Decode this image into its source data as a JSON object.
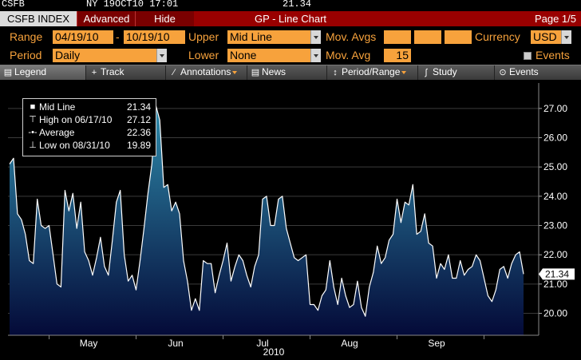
{
  "ticker": {
    "code": "CSFB",
    "exchange_date": "NY 19OCT10 17:01",
    "last": "21.34"
  },
  "titlebar": {
    "index_label": "CSFB INDEX",
    "advanced_label": "Advanced",
    "hide_label": "Hide",
    "title": "GP - Line Chart",
    "page": "Page 1/5"
  },
  "controls": {
    "range_label": "Range",
    "range_start": "04/19/10",
    "range_dash": "-",
    "range_end": "10/19/10",
    "upper_label": "Upper",
    "upper_value": "Mid Line",
    "mov_avgs_label": "Mov. Avgs",
    "currency_label": "Currency",
    "currency_value": "USD",
    "period_label": "Period",
    "period_value": "Daily",
    "lower_label": "Lower",
    "lower_value": "None",
    "mov_avg_label": "Mov. Avg",
    "mov_avg_value": "15",
    "events_label": "Events"
  },
  "toolbar": {
    "legend": "Legend",
    "track": "Track",
    "annotations": "Annotations",
    "news": "News",
    "period_range": "Period/Range",
    "study": "Study",
    "events": "Events"
  },
  "legend": {
    "mid_label": "Mid Line",
    "mid_value": "21.34",
    "high_label": "High on 06/17/10",
    "high_value": "27.12",
    "avg_label": "Average",
    "avg_value": "22.36",
    "low_label": "Low on 08/31/10",
    "low_value": "19.89"
  },
  "chart_data": {
    "type": "area",
    "year_label": "2010",
    "last_value": 21.34,
    "ylim": [
      19.25,
      27.65
    ],
    "y_ticks": [
      "27.00",
      "26.00",
      "25.00",
      "24.00",
      "23.00",
      "22.00",
      "21.00",
      "20.00"
    ],
    "x_ticks": [
      {
        "label": "May",
        "at": 20.0
      },
      {
        "label": "Jun",
        "at": 42.0
      },
      {
        "label": "Jul",
        "at": 64.0
      },
      {
        "label": "Aug",
        "at": 86.0
      },
      {
        "label": "Sep",
        "at": 108.0
      }
    ],
    "colors": {
      "line": "#ffffff",
      "fill_top": "#2f8cac",
      "fill_bottom": "#040a38",
      "grid": "#3a3a3a",
      "axis_text": "#ffffff"
    },
    "series": [
      {
        "x": [
          0,
          1,
          2,
          3,
          4,
          5,
          6,
          7,
          8,
          9,
          10,
          11,
          12,
          13,
          14,
          15,
          16,
          17,
          18,
          19,
          20,
          21,
          22,
          23,
          24,
          25,
          26,
          27,
          28,
          29,
          30,
          31,
          32,
          33,
          34,
          35,
          36,
          37,
          38,
          39,
          40,
          41,
          42,
          43,
          44,
          45,
          46,
          47,
          48,
          49,
          50,
          51,
          52,
          53,
          54,
          55,
          56,
          57,
          58,
          59,
          60,
          61,
          62,
          63,
          64,
          65,
          66,
          67,
          68,
          69,
          70,
          71,
          72,
          73,
          74,
          75,
          76,
          77,
          78,
          79,
          80,
          81,
          82,
          83,
          84,
          85,
          86,
          87,
          88,
          89,
          90,
          91,
          92,
          93,
          94,
          95,
          96,
          97,
          98,
          99,
          100,
          101,
          102,
          103,
          104,
          105,
          106,
          107,
          108,
          109,
          110,
          111,
          112,
          113,
          114,
          115,
          116,
          117,
          118,
          119,
          120,
          121,
          122,
          123,
          124,
          125,
          126,
          127,
          128,
          129,
          130
        ],
        "values": [
          25.1,
          25.3,
          23.4,
          23.2,
          22.7,
          21.8,
          21.7,
          23.9,
          23.0,
          22.9,
          23.0,
          22.0,
          21.0,
          20.9,
          24.2,
          23.5,
          24.1,
          22.9,
          23.8,
          22.1,
          21.8,
          21.3,
          21.9,
          22.6,
          21.6,
          21.3,
          22.5,
          23.8,
          24.2,
          22.0,
          21.1,
          21.3,
          20.8,
          21.8,
          22.9,
          24.1,
          25.1,
          27.1,
          26.6,
          24.3,
          24.4,
          23.5,
          23.8,
          23.4,
          21.8,
          21.1,
          20.1,
          20.5,
          20.1,
          21.8,
          21.7,
          21.7,
          20.7,
          21.3,
          21.8,
          22.4,
          21.1,
          21.6,
          22.0,
          21.8,
          21.3,
          20.9,
          21.6,
          22.0,
          23.9,
          24.0,
          23.0,
          23.0,
          23.9,
          24.0,
          22.9,
          22.4,
          21.9,
          21.8,
          21.9,
          22.0,
          20.3,
          20.3,
          20.1,
          20.6,
          20.8,
          21.8,
          20.9,
          20.3,
          21.2,
          20.6,
          20.2,
          20.3,
          21.1,
          20.2,
          19.9,
          20.9,
          21.4,
          22.3,
          21.7,
          21.9,
          22.5,
          22.7,
          23.9,
          23.1,
          23.8,
          23.7,
          24.4,
          22.7,
          22.8,
          23.4,
          22.4,
          22.3,
          21.2,
          21.7,
          21.5,
          22.0,
          21.2,
          21.2,
          21.8,
          21.3,
          21.5,
          21.6,
          22.0,
          21.8,
          21.2,
          20.6,
          20.4,
          20.8,
          21.5,
          21.6,
          21.2,
          21.7,
          22.0,
          22.1,
          21.34
        ]
      }
    ]
  }
}
